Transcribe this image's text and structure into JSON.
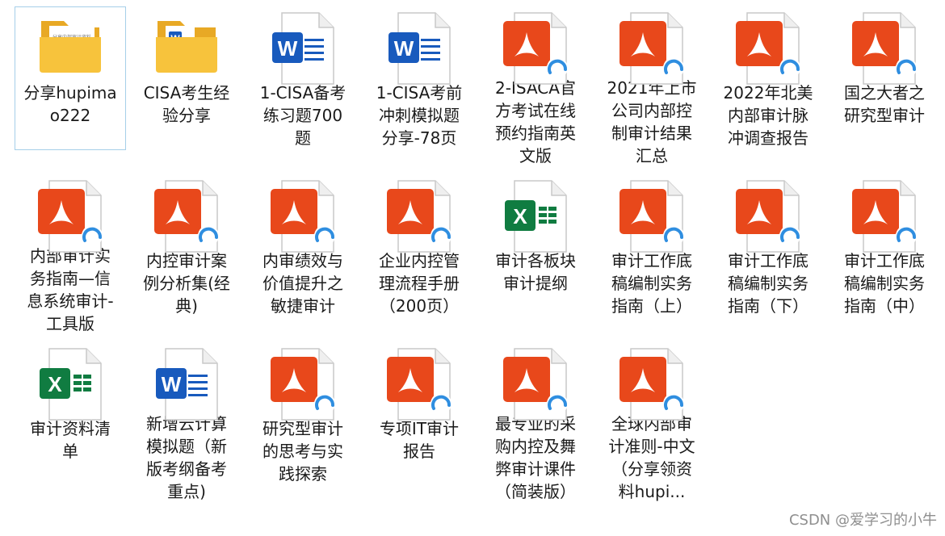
{
  "explorer": {
    "selected_index": 0,
    "items": [
      {
        "label": "分享hupimao222",
        "icon": "folder-icon"
      },
      {
        "label": "CISA考生经验分享",
        "icon": "folder-word-icon"
      },
      {
        "label": "1-CISA备考练习题700题",
        "icon": "word-file-icon"
      },
      {
        "label": "1-CISA考前冲刺模拟题分享-78页",
        "icon": "word-file-icon"
      },
      {
        "label": "2-ISACA官方考试在线预约指南英文版",
        "icon": "pdf-file-icon"
      },
      {
        "label": "2021年上市公司内部控制审计结果汇总",
        "icon": "pdf-file-icon"
      },
      {
        "label": "2022年北美内部审计脉冲调查报告",
        "icon": "pdf-file-icon"
      },
      {
        "label": "国之大者之研究型审计",
        "icon": "pdf-file-icon"
      },
      {
        "label": "内部审计实务指南—信息系统审计-工具版",
        "icon": "pdf-file-icon"
      },
      {
        "label": "内控审计案例分析集(经典)",
        "icon": "pdf-file-icon"
      },
      {
        "label": "内审绩效与价值提升之敏捷审计",
        "icon": "pdf-file-icon"
      },
      {
        "label": "企业内控管理流程手册（200页）",
        "icon": "pdf-file-icon"
      },
      {
        "label": "审计各板块审计提纲",
        "icon": "excel-file-icon"
      },
      {
        "label": "审计工作底稿编制实务指南（上）",
        "icon": "pdf-file-icon"
      },
      {
        "label": "审计工作底稿编制实务指南（下）",
        "icon": "pdf-file-icon"
      },
      {
        "label": "审计工作底稿编制实务指南（中）",
        "icon": "pdf-file-icon"
      },
      {
        "label": "审计资料清单",
        "icon": "excel-file-icon"
      },
      {
        "label": "新增云计算模拟题（新版考纲备考重点)",
        "icon": "word-file-icon"
      },
      {
        "label": "研究型审计的思考与实践探索",
        "icon": "pdf-file-icon"
      },
      {
        "label": "专项IT审计报告",
        "icon": "pdf-file-icon"
      },
      {
        "label": "最专业的采购内控及舞弊审计课件（简装版）",
        "icon": "pdf-file-icon"
      },
      {
        "label": "全球内部审计准则-中文（分享领资料hupi...",
        "icon": "pdf-file-icon"
      }
    ]
  },
  "folder_preview_text": "分享内部审计资料",
  "watermark": "CSDN @爱学习的小牛",
  "colors": {
    "pdf": "#e8481b",
    "word": "#185abd",
    "excel": "#107c41",
    "folder": "#f7c33c",
    "selection_border": "#a6cfe9"
  }
}
